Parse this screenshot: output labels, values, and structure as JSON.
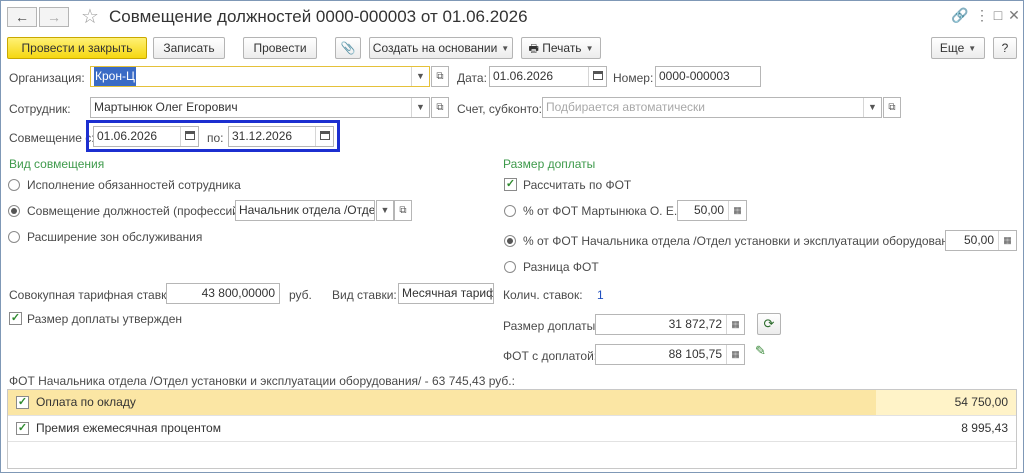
{
  "title": "Совмещение должностей 0000-000003 от 01.06.2026",
  "nav": {
    "back": "←",
    "forward": "→"
  },
  "window_controls": {
    "link": "🔗",
    "menu": "⋮",
    "maximize": "□",
    "close": "✕"
  },
  "toolbar": {
    "post_close": "Провести и закрыть",
    "save": "Записать",
    "post": "Провести",
    "create_based": "Создать на основании",
    "print": "Печать",
    "more": "Еще",
    "help": "?"
  },
  "organization": {
    "label": "Организация:",
    "value": "Крон-Ц"
  },
  "date": {
    "label": "Дата:",
    "value": "01.06.2026"
  },
  "number": {
    "label": "Номер:",
    "value": "0000-000003"
  },
  "employee": {
    "label": "Сотрудник:",
    "value": "Мартынюк Олег Егорович"
  },
  "account": {
    "label": "Счет, субконто:",
    "placeholder": "Подбирается автоматически"
  },
  "period": {
    "label": "Совмещение с:",
    "from": "01.06.2026",
    "to_label": "по:",
    "to": "31.12.2026"
  },
  "kind": {
    "title": "Вид совмещения",
    "options": [
      "Исполнение обязанностей сотрудника",
      "Совмещение должностей (профессий)",
      "Расширение зон обслуживания"
    ],
    "selected": 1,
    "position_value": "Начальник отдела /Отдел"
  },
  "surcharge": {
    "title": "Размер доплаты",
    "calc_by_fot": "Рассчитать по ФОТ",
    "opt1": "% от ФОТ Мартынюка О. Е.",
    "opt1_value": "50,00",
    "opt2": "% от ФОТ Начальника отдела /Отдел установки и эксплуатации оборудования/",
    "opt2_value": "50,00",
    "opt3": "Разница ФОТ",
    "selected": 2
  },
  "tariff": {
    "label": "Совокупная тарифная ставка:",
    "value": "43 800,00000",
    "unit": "руб.",
    "type_label": "Вид ставки:",
    "type_value": "Месячная тариф"
  },
  "rates_count": {
    "label": "Колич. ставок:",
    "value": "1"
  },
  "approved": {
    "label": "Размер доплаты утвержден"
  },
  "surcharge_amount": {
    "label": "Размер доплаты:",
    "value": "31 872,72"
  },
  "fot_with_surcharge": {
    "label": "ФОТ с доплатой:",
    "value": "88 105,75"
  },
  "fot_caption": "ФОТ Начальника отдела /Отдел установки и эксплуатации оборудования/ - 63 745,43 руб.:",
  "table": [
    {
      "name": "Оплата по окладу",
      "amount": "54 750,00"
    },
    {
      "name": "Премия ежемесячная процентом",
      "amount": "8 995,43"
    }
  ],
  "colors": {
    "accent_yellow": "#f5d712",
    "section_green": "#3e9a4b",
    "highlight_blue": "#1c2fd0",
    "row_selected": "#fbe6a4"
  }
}
